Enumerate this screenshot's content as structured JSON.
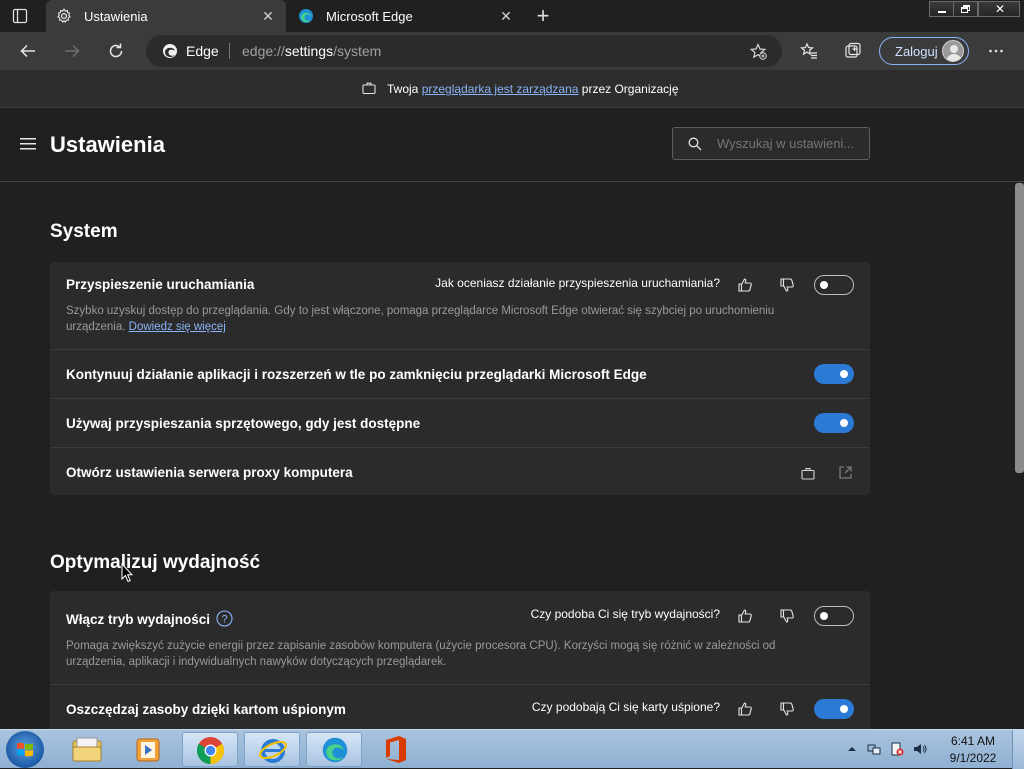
{
  "browser": {
    "tabs": [
      {
        "label": "Ustawienia",
        "icon": "gear-icon",
        "active": true
      },
      {
        "label": "Microsoft Edge",
        "icon": "edge-icon",
        "active": false
      }
    ],
    "new_tab_label": "+",
    "address": {
      "brand": "Edge",
      "url_prefix": "edge://",
      "url_host": "settings",
      "url_path": "/system"
    },
    "signin_label": "Zaloguj"
  },
  "managed_bar": {
    "prefix": "Twoja ",
    "link": "przeglądarka jest zarządzana",
    "suffix": " przez Organizację"
  },
  "settings": {
    "title": "Ustawienia",
    "search_placeholder": "Wyszukaj w ustawieni..."
  },
  "sections": {
    "system": {
      "title": "System",
      "startup_boost": {
        "title": "Przyspieszenie uruchamiania",
        "feedback": "Jak oceniasz działanie przyspieszenia uruchamiania?",
        "desc": "Szybko uzyskuj dostęp do przeglądania. Gdy to jest włączone, pomaga przeglądarce Microsoft Edge otwierać się szybciej po uruchomieniu urządzenia. ",
        "link": "Dowiedz się więcej",
        "enabled": false
      },
      "background_apps": {
        "title": "Kontynuuj działanie aplikacji i rozszerzeń w tle po zamknięciu przeglądarki Microsoft Edge",
        "enabled": true
      },
      "hardware_accel": {
        "title": "Używaj przyspieszania sprzętowego, gdy jest dostępne",
        "enabled": true
      },
      "proxy": {
        "title": "Otwórz ustawienia serwera proxy komputera"
      }
    },
    "performance": {
      "title": "Optymalizuj wydajność",
      "efficiency_mode": {
        "title": "Włącz tryb wydajności",
        "feedback": "Czy podoba Ci się tryb wydajności?",
        "desc": "Pomaga zwiększyć zużycie energii przez zapisanie zasobów komputera (użycie procesora CPU). Korzyści mogą się różnić w zależności od urządzenia, aplikacji i indywidualnych nawyków dotyczących przeglądarek.",
        "enabled": false
      },
      "sleeping_tabs": {
        "title": "Oszczędzaj zasoby dzięki kartom uśpionym",
        "feedback": "Czy podobają Ci się karty uśpione?",
        "enabled": true
      }
    }
  },
  "taskbar": {
    "apps": [
      "explorer-icon",
      "media-player-icon",
      "chrome-icon",
      "internet-explorer-icon",
      "edge-icon",
      "office-icon"
    ],
    "time": "6:41 AM",
    "date": "9/1/2022"
  },
  "colors": {
    "accent": "#2b7bd6",
    "link": "#8ab4f8",
    "background": "#202020",
    "card": "#2b2b2b"
  }
}
